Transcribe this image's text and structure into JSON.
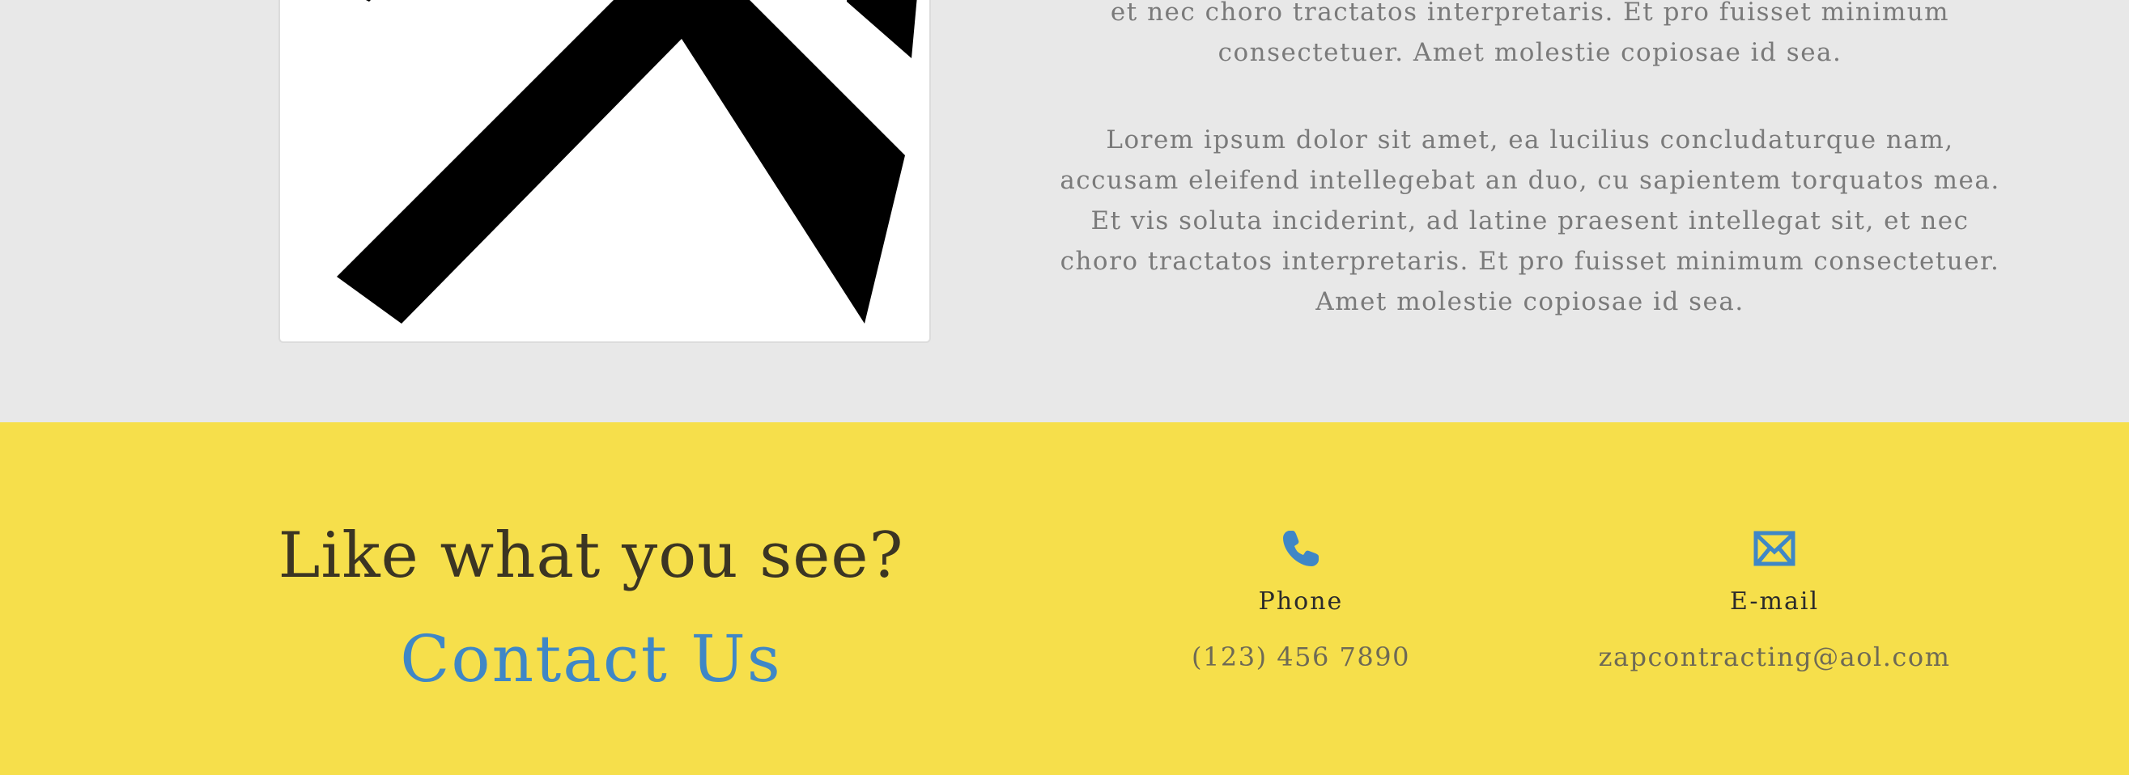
{
  "about": {
    "paragraph_partial": "et nec choro tractatos interpretaris. Et pro fuisset minimum consectetuer. Amet molestie copiosae id sea.",
    "paragraph_full": "Lorem ipsum dolor sit amet, ea lucilius concludaturque nam, accusam eleifend intellegebat an duo, cu sapientem torquatos mea. Et vis soluta inciderint, ad latine praesent intellegat sit, et nec choro tractatos interpretaris. Et pro fuisset minimum consectetuer. Amet molestie copiosae id sea."
  },
  "contact": {
    "question": "Like what you see?",
    "link_label": "Contact Us",
    "phone": {
      "icon": "phone-icon",
      "label": "Phone",
      "value": "(123) 456 7890"
    },
    "email": {
      "icon": "mail-icon",
      "label": "E-mail",
      "value": "zapcontracting@aol.com"
    }
  },
  "colors": {
    "band_yellow": "#f6df4b",
    "link_blue": "#3f87c6",
    "page_gray": "#e8e8e8"
  }
}
